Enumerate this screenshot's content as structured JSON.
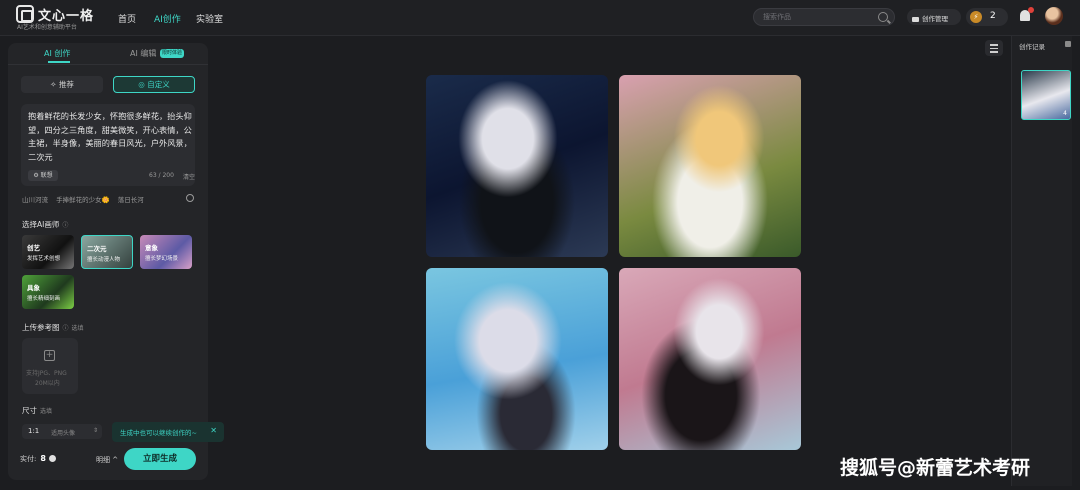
{
  "header": {
    "brand": "文心一格",
    "brand_sub": "AI艺术和创意辅助平台",
    "nav": [
      "首页",
      "AI创作",
      "实验室"
    ],
    "search_placeholder": "搜索作品",
    "manage_label": "创作管理",
    "coin_count": "2",
    "accent": "#3ed6c6"
  },
  "panel": {
    "tabs": [
      "AI 创作",
      "AI 编辑"
    ],
    "tab_badge": "限时体验",
    "modes": [
      "推荐",
      "自定义"
    ],
    "prompt": "抱着鲜花的长发少女，怀抱很多鲜花，抬头仰望，四分之三角度，甜美微笑，开心表情，公主裙，半身像，美丽的春日风光，户外风景，二次元",
    "lenovo_label": "联想",
    "char_count": "63 / 200",
    "clear_label": "清空",
    "suggestions": [
      "山川河流",
      "手捧鲜花的少女🌼",
      "落日长河"
    ],
    "painter_title": "选择AI画师",
    "painters": [
      {
        "name": "创艺",
        "desc": "发挥艺术创想"
      },
      {
        "name": "二次元",
        "desc": "擅长动漫人物"
      },
      {
        "name": "意象",
        "desc": "擅长梦幻场景"
      },
      {
        "name": "具象",
        "desc": "擅长精细刻画"
      }
    ],
    "upload_title": "上传参考图",
    "upload_optional": "选填",
    "upload_hint1": "支持JPG、PNG",
    "upload_hint2": "20M以内",
    "size_title": "尺寸",
    "size_optional": "选填",
    "ratio": "1:1",
    "ratio_use": "适用头像",
    "toast": "生成中也可以继续创作的~",
    "cost_label": "实付:",
    "cost_value": "8",
    "detail_label": "明细",
    "generate_label": "立即生成"
  },
  "history": {
    "title": "创作记录",
    "count": "4"
  },
  "watermark": "搜狐号@新蕾艺术考研"
}
